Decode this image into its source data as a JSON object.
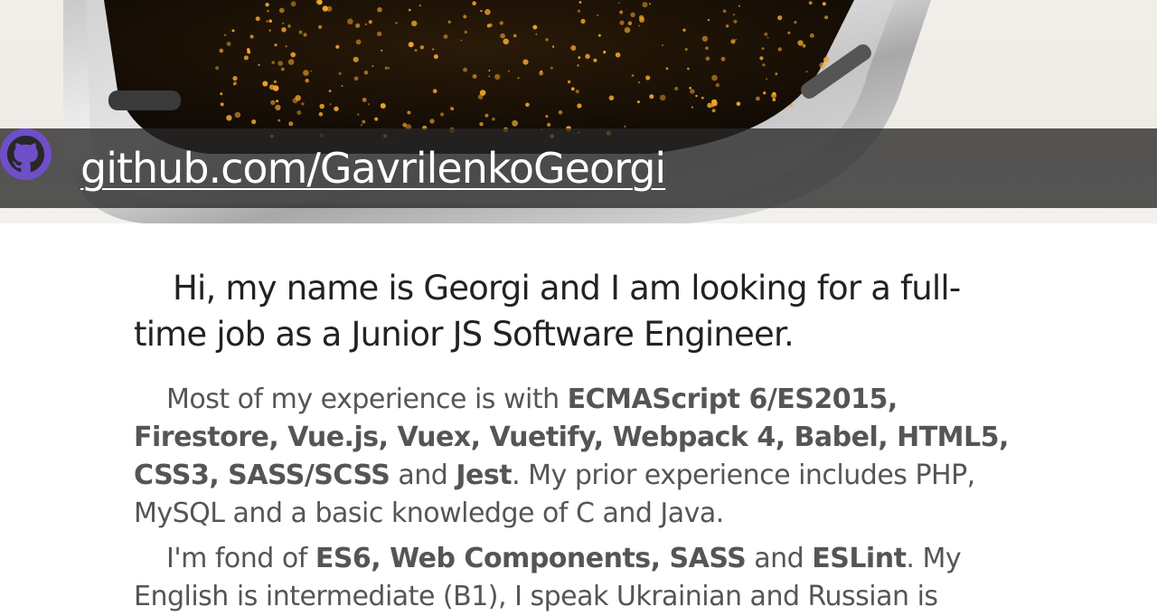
{
  "header": {
    "github_link": "github.com/GavrilenkoGeorgi",
    "icon": "github-icon",
    "banner_color": "#282828",
    "icon_color": "#6e4fc9"
  },
  "intro": {
    "heading": "Hi, my name is Georgi and I am looking for a full-time job as a Junior JS Software Engineer."
  },
  "experience": {
    "lead": "Most of my experience is with ",
    "skills": "ECMAScript 6/ES2015, Firestore, Vue.js, Vuex, Vuetify, Webpack 4, Babel, HTML5, CSS3, SASS/SCSS",
    "and": " and ",
    "last_skill": "Jest",
    "rest": ". My prior experience includes PHP, MySQL and a basic knowledge of C and Java."
  },
  "interests": {
    "lead": "I'm fond of ",
    "items": "ES6, Web Components, SASS",
    "and": " and ",
    "last_item": "ESLint",
    "rest": ". My English is intermediate (B1), I speak Ukrainian and Russian is"
  }
}
